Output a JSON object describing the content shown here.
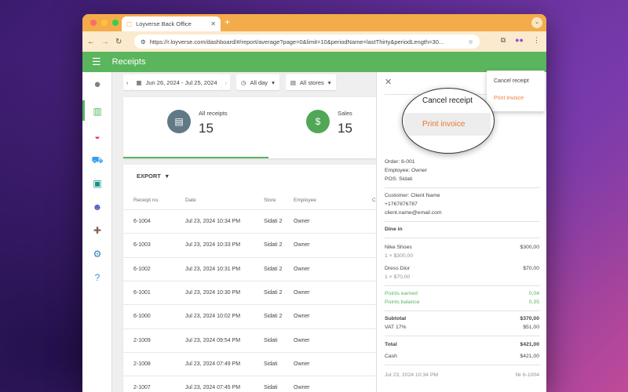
{
  "browser": {
    "tab_title": "Loyverse Back Office",
    "url": "https://r.loyverse.com/dashboard/#/report/average?page=0&limit=10&periodName=lastThirty&periodLength=30..."
  },
  "app": {
    "title": "Receipts"
  },
  "filters": {
    "date_range": "Jun 26, 2024 - Jul 25, 2024",
    "time": "All day",
    "stores": "All stores"
  },
  "summary": {
    "all_receipts_label": "All receipts",
    "all_receipts_value": "15",
    "sales_label": "Sales",
    "sales_value": "15"
  },
  "table": {
    "export_label": "EXPORT",
    "headers": [
      "Receipt no.",
      "Date",
      "Store",
      "Employee",
      "C"
    ],
    "rows": [
      {
        "no": "6-1004",
        "date": "Jul 23, 2024 10:34 PM",
        "store": "Sidati 2",
        "employee": "Owner"
      },
      {
        "no": "6-1003",
        "date": "Jul 23, 2024 10:33 PM",
        "store": "Sidati 2",
        "employee": "Owner"
      },
      {
        "no": "6-1002",
        "date": "Jul 23, 2024 10:31 PM",
        "store": "Sidati 2",
        "employee": "Owner"
      },
      {
        "no": "6-1001",
        "date": "Jul 23, 2024 10:30 PM",
        "store": "Sidati 2",
        "employee": "Owner"
      },
      {
        "no": "6-1000",
        "date": "Jul 23, 2024 10:02 PM",
        "store": "Sidati 2",
        "employee": "Owner"
      },
      {
        "no": "2-1009",
        "date": "Jul 23, 2024 09:54 PM",
        "store": "Sidati",
        "employee": "Owner"
      },
      {
        "no": "2-1008",
        "date": "Jul 23, 2024 07:49 PM",
        "store": "Sidati",
        "employee": "Owner"
      },
      {
        "no": "2-1007",
        "date": "Jul 23, 2024 07:45 PM",
        "store": "Sidati",
        "employee": "Owner"
      }
    ]
  },
  "receipt": {
    "order": "Order: 6-001",
    "employee": "Employee: Owner",
    "pos": "POS: Sidati",
    "customer": "Customer: Client Name",
    "phone": "+1767876787",
    "email": "client.name@email.com",
    "dining": "Dine in",
    "item1_name": "Nike Shoes",
    "item1_qty": "1 × $300,00",
    "item1_price": "$300,00",
    "item2_name": "Dress Dior",
    "item2_qty": "1 × $70,00",
    "item2_price": "$70,00",
    "points_earned_label": "Points earned",
    "points_earned_value": "0,04",
    "points_balance_label": "Points balance",
    "points_balance_value": "0,35",
    "subtotal_label": "Subtotal",
    "subtotal_value": "$370,00",
    "vat_label": "VAT 17%",
    "vat_value": "$51,00",
    "total_label": "Total",
    "total_value": "$421,00",
    "cash_label": "Cash",
    "cash_value": "$421,00",
    "footer_date": "Jul 23, 2024 10:34 PM",
    "footer_no": "№ 6-1004"
  },
  "menu": {
    "cancel_receipt": "Cancel receipt",
    "print_invoice": "Print invoice"
  },
  "colors": {
    "brand_green": "#4caf50",
    "tab_orange": "#f3a43b",
    "accent_orange": "#e8792b"
  }
}
